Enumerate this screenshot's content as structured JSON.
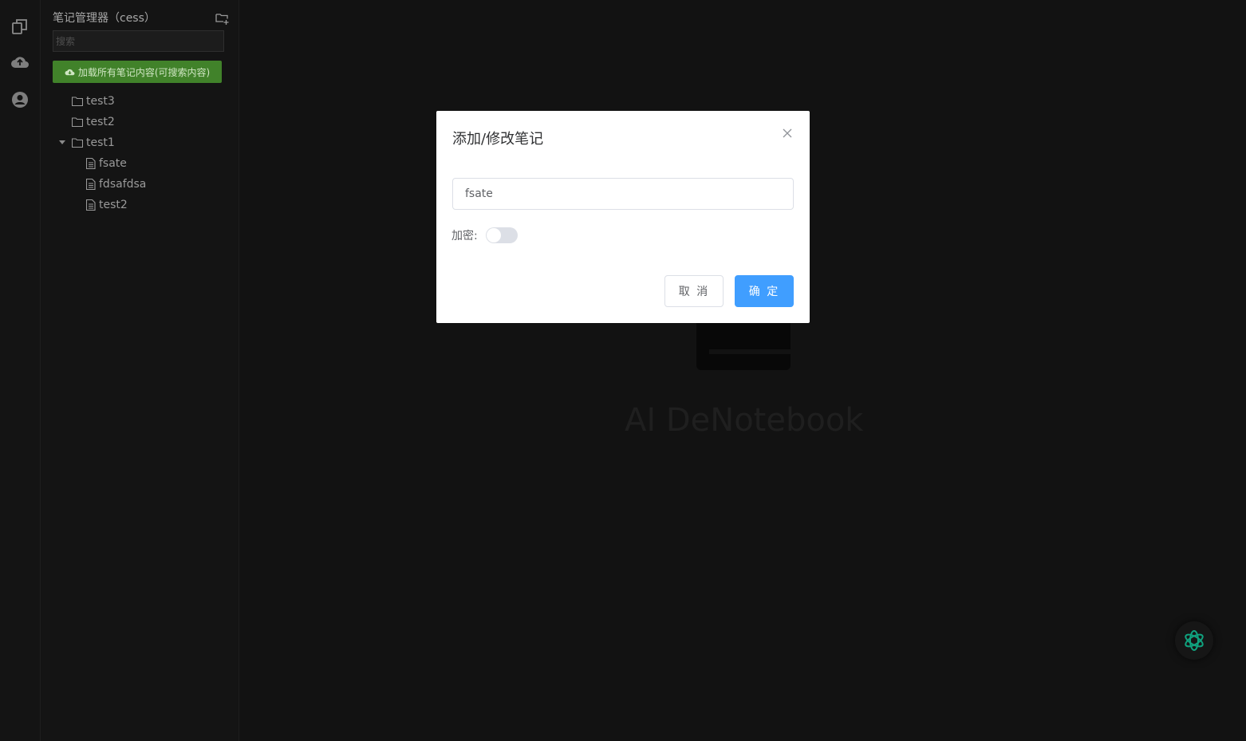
{
  "rail": {
    "icons": [
      "copy-icon",
      "cloud-upload-icon",
      "user-circle-icon"
    ]
  },
  "sidebar": {
    "title": "笔记管理器（cess）",
    "search_placeholder": "搜索",
    "load_all_label": "加载所有笔记内容(可搜索内容)",
    "tree": [
      {
        "type": "folder",
        "label": "test3",
        "expanded": false
      },
      {
        "type": "folder",
        "label": "test2",
        "expanded": false
      },
      {
        "type": "folder",
        "label": "test1",
        "expanded": true,
        "children": [
          {
            "type": "file",
            "label": "fsate"
          },
          {
            "type": "file",
            "label": "fdsafdsa"
          },
          {
            "type": "file",
            "label": "test2"
          }
        ]
      }
    ]
  },
  "main": {
    "brand_text": "AI DeNotebook"
  },
  "dialog": {
    "title": "添加/修改笔记",
    "name_value": "fsate",
    "encrypt_label": "加密:",
    "encrypt_on": false,
    "cancel_label": "取 消",
    "confirm_label": "确 定"
  },
  "colors": {
    "primary": "#409eff",
    "success": "#41822a",
    "ai_accent": "#10a37f"
  }
}
